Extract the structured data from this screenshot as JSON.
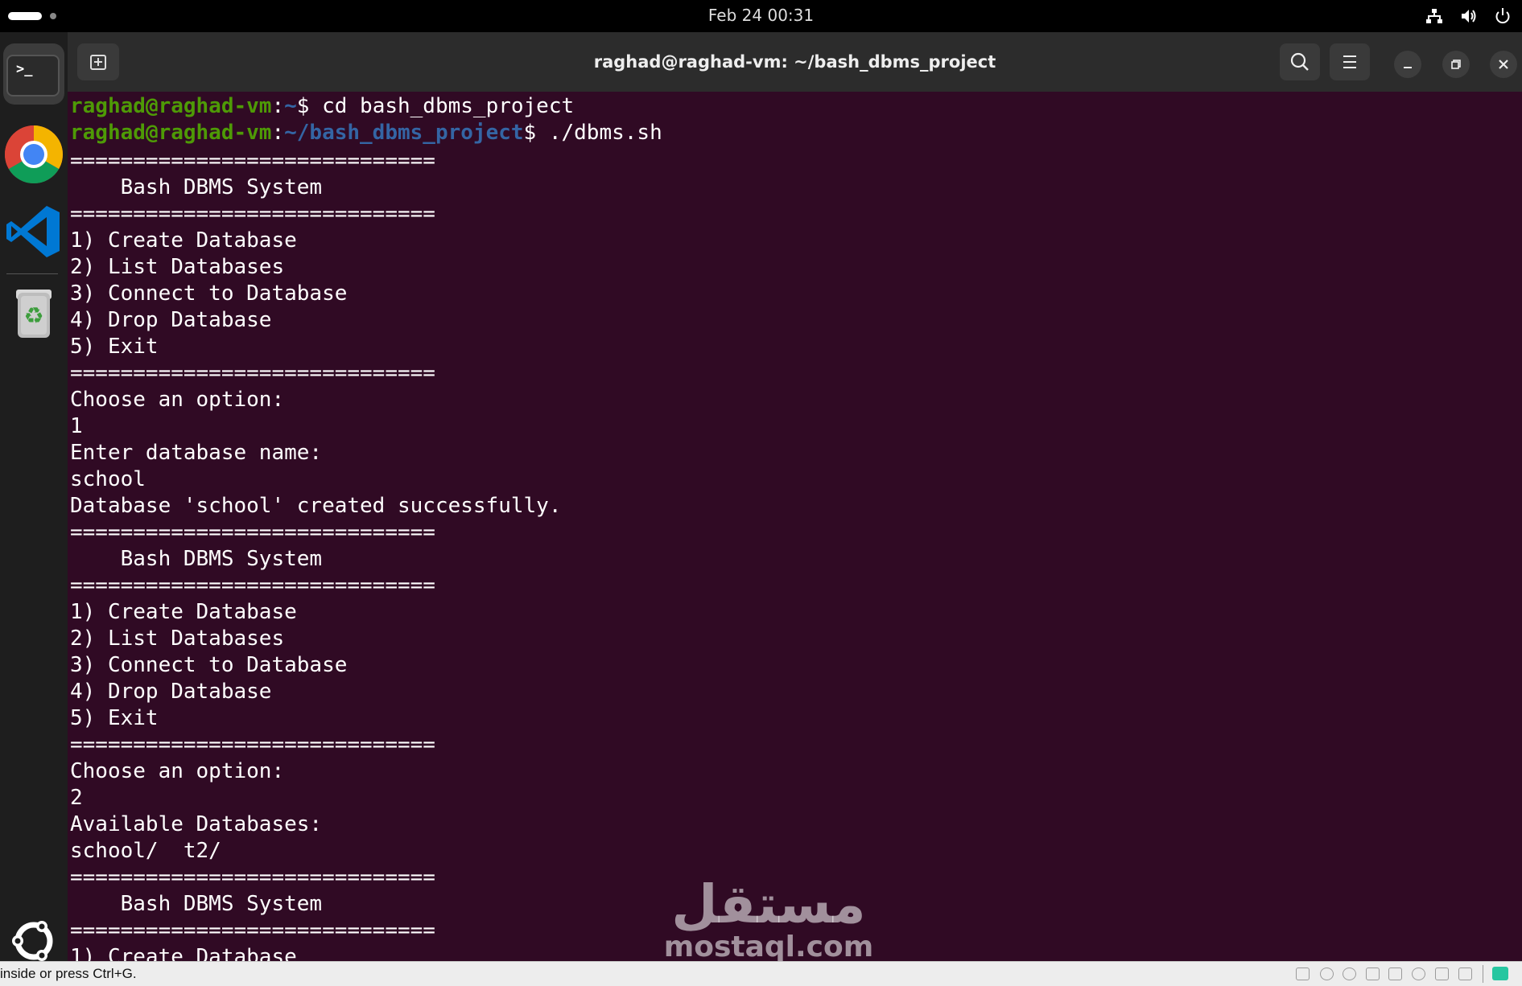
{
  "topbar": {
    "clock": "Feb 24  00:31",
    "icons": [
      "network-icon",
      "volume-icon",
      "power-icon"
    ]
  },
  "dock": {
    "items": [
      {
        "name": "terminal",
        "icon": "terminal-icon",
        "glyph": ">_"
      },
      {
        "name": "chrome",
        "icon": "chrome-icon"
      },
      {
        "name": "vscode",
        "icon": "vscode-icon"
      },
      {
        "name": "trash",
        "icon": "trash-icon"
      },
      {
        "name": "ubuntu",
        "icon": "ubuntu-logo-icon"
      }
    ]
  },
  "window": {
    "title": "raghad@raghad-vm: ~/bash_dbms_project",
    "buttons": [
      "new-tab-icon",
      "search-icon",
      "hamburger-icon",
      "minimize-icon",
      "restore-icon",
      "close-icon"
    ]
  },
  "terminal": {
    "prompt_user": "raghad@raghad-vm",
    "prompt_home": "~",
    "prompt_project": "~/bash_dbms_project",
    "cmd1": "cd bash_dbms_project",
    "cmd2": "./dbms.sh",
    "lines": [
      "=============================",
      "    Bash DBMS System",
      "=============================",
      "1) Create Database",
      "2) List Databases",
      "3) Connect to Database",
      "4) Drop Database",
      "5) Exit",
      "=============================",
      "Choose an option:",
      "1",
      "Enter database name:",
      "school",
      "Database 'school' created successfully.",
      "=============================",
      "    Bash DBMS System",
      "=============================",
      "1) Create Database",
      "2) List Databases",
      "3) Connect to Database",
      "4) Drop Database",
      "5) Exit",
      "=============================",
      "Choose an option:",
      "2",
      "Available Databases:",
      "school/  t2/",
      "=============================",
      "    Bash DBMS System",
      "=============================",
      "1) Create Database"
    ]
  },
  "watermark": {
    "arabic": "مستقل",
    "latin": "mostaql.com"
  },
  "statusbar": {
    "text": "inside or press Ctrl+G."
  },
  "colors": {
    "terminal_bg": "#300a24",
    "prompt_user": "#4e9a06",
    "prompt_path": "#3465a4",
    "headerbar": "#2c2c2c"
  }
}
